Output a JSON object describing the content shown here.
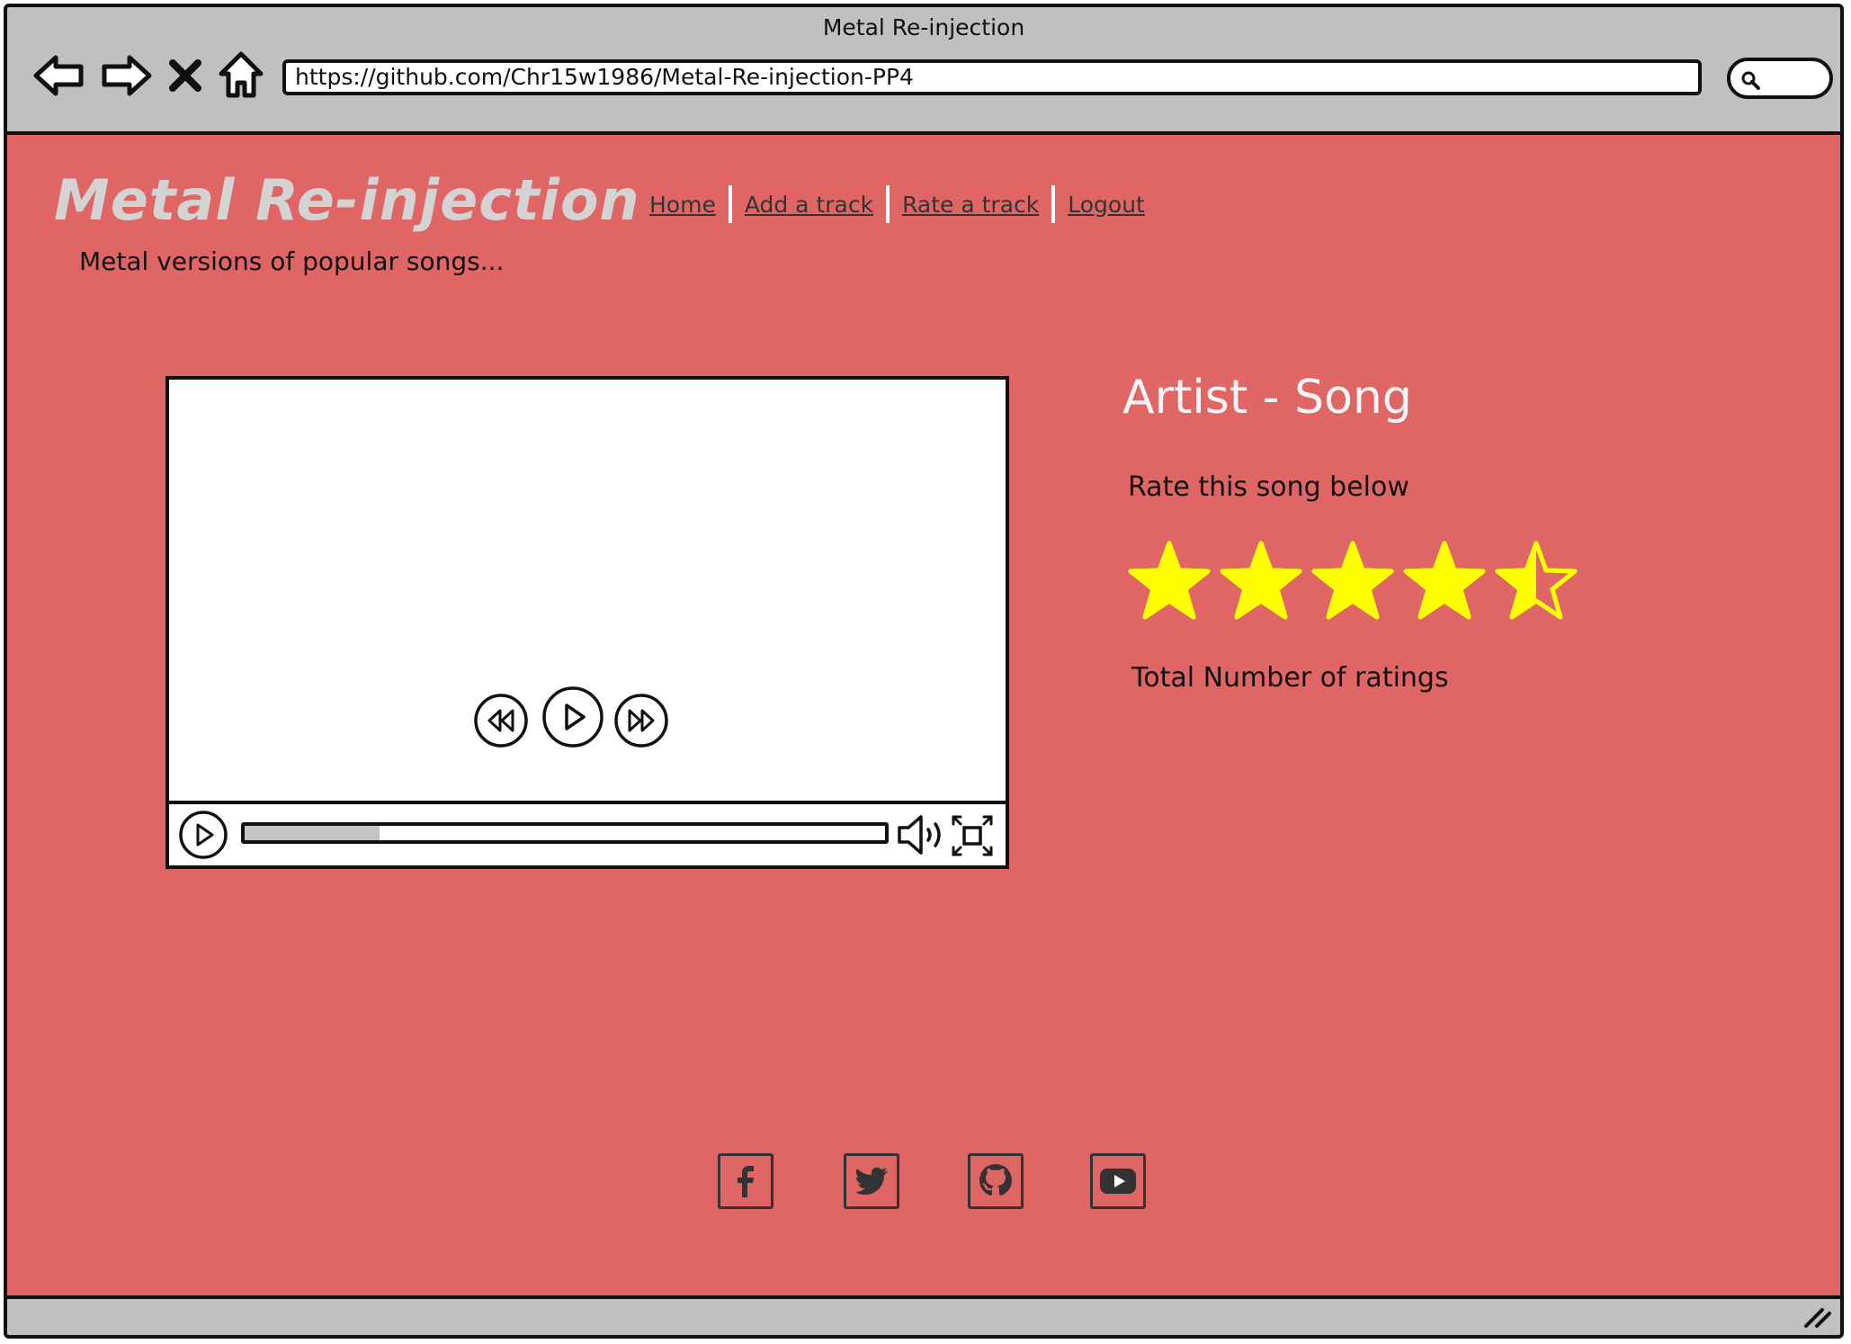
{
  "window": {
    "title": "Metal Re-injection",
    "url": "https://github.com/Chr15w1986/Metal-Re-injection-PP4"
  },
  "toolbar": {
    "back_icon": "back-arrow-icon",
    "forward_icon": "forward-arrow-icon",
    "stop_icon": "close-icon",
    "home_icon": "home-icon",
    "search_icon": "search-icon"
  },
  "site": {
    "title": "Metal Re-injection",
    "tagline": "Metal versions of popular songs...",
    "nav": [
      {
        "label": "Home"
      },
      {
        "label": "Add a track"
      },
      {
        "label": "Rate a track"
      },
      {
        "label": "Logout"
      }
    ]
  },
  "player": {
    "progress": 0.21,
    "controls": [
      "rewind-icon",
      "play-icon",
      "fast-forward-icon",
      "volume-icon",
      "fullscreen-icon"
    ]
  },
  "track": {
    "title": "Artist - Song",
    "rate_prompt": "Rate this song below",
    "rating": 4.5,
    "rating_max": 5,
    "star_color": "#ffff00",
    "ratings_label": "Total Number of ratings"
  },
  "social": [
    "facebook-icon",
    "twitter-icon",
    "github-icon",
    "youtube-icon"
  ],
  "colors": {
    "page_background": "#e06666",
    "chrome": "#c0c0c0",
    "title_text": "#d3d3d3"
  }
}
